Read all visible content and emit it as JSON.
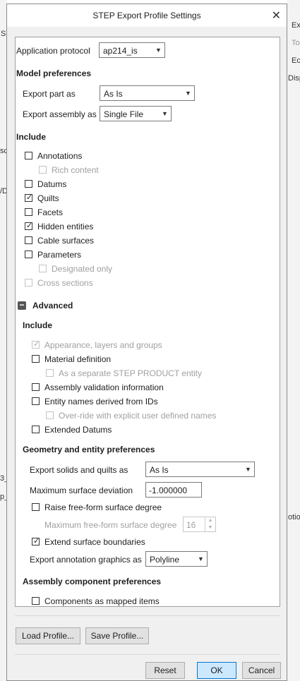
{
  "background": {
    "right_fragments": [
      "Ex",
      "To",
      "Ec",
      "Disp",
      "otio"
    ],
    "left_fragments": [
      "S",
      "sc",
      "/D",
      "3_",
      "p_"
    ]
  },
  "dialog": {
    "title": "STEP Export Profile Settings",
    "application_protocol": {
      "label": "Application protocol",
      "value": "ap214_is"
    },
    "model_preferences": {
      "heading": "Model preferences",
      "export_part_as": {
        "label": "Export part as",
        "value": "As Is"
      },
      "export_assembly_as": {
        "label": "Export assembly as",
        "value": "Single File"
      }
    },
    "include": {
      "heading": "Include",
      "items": [
        {
          "label": "Annotations",
          "checked": false,
          "disabled": false
        },
        {
          "label": "Rich content",
          "checked": false,
          "disabled": true
        },
        {
          "label": "Datums",
          "checked": false,
          "disabled": false
        },
        {
          "label": "Quilts",
          "checked": true,
          "disabled": false
        },
        {
          "label": "Facets",
          "checked": false,
          "disabled": false
        },
        {
          "label": "Hidden entities",
          "checked": true,
          "disabled": false
        },
        {
          "label": "Cable surfaces",
          "checked": false,
          "disabled": false
        },
        {
          "label": "Parameters",
          "checked": false,
          "disabled": false
        },
        {
          "label": "Designated only",
          "checked": false,
          "disabled": true
        },
        {
          "label": "Cross sections",
          "checked": false,
          "disabled": true
        }
      ]
    },
    "advanced": {
      "label": "Advanced",
      "include_heading": "Include",
      "include_items": [
        {
          "label": "Appearance, layers and groups",
          "checked": true,
          "disabled": true
        },
        {
          "label": "Material definition",
          "checked": false,
          "disabled": false
        },
        {
          "label": "As a separate STEP PRODUCT entity",
          "checked": false,
          "disabled": true
        },
        {
          "label": "Assembly validation information",
          "checked": false,
          "disabled": false
        },
        {
          "label": "Entity names derived from IDs",
          "checked": false,
          "disabled": false
        },
        {
          "label": "Over-ride with explicit user defined names",
          "checked": false,
          "disabled": true
        },
        {
          "label": "Extended Datums",
          "checked": false,
          "disabled": false
        }
      ],
      "geometry_heading": "Geometry and entity preferences",
      "export_solids": {
        "label": "Export solids and quilts as",
        "value": "As Is"
      },
      "max_surface_deviation": {
        "label": "Maximum surface deviation",
        "value": "-1.000000"
      },
      "raise_freeform": {
        "label": "Raise free-form surface degree",
        "checked": false
      },
      "max_freeform_degree": {
        "label": "Maximum free-form surface degree",
        "value": "16"
      },
      "extend_surface": {
        "label": "Extend surface boundaries",
        "checked": true
      },
      "export_annotation": {
        "label": "Export annotation graphics as",
        "value": "Polyline"
      },
      "assembly_heading": "Assembly component preferences",
      "components_mapped": {
        "label": "Components as mapped items",
        "checked": false
      }
    },
    "buttons": {
      "load_profile": "Load Profile...",
      "save_profile": "Save Profile...",
      "reset": "Reset",
      "ok": "OK",
      "cancel": "Cancel"
    }
  }
}
